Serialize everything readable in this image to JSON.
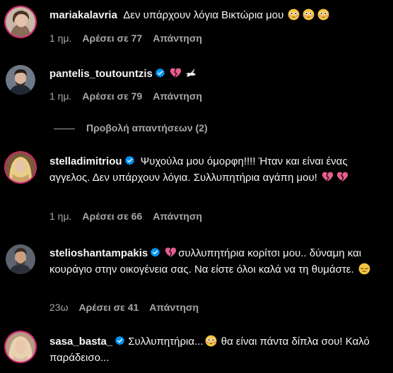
{
  "comments": [
    {
      "username": "mariakalavria",
      "verified": false,
      "text": "Δεν υπάρχουν λόγια Βικτώρια μου",
      "emojis": [
        "flushed-emoji",
        "flushed-emoji",
        "flushed-emoji"
      ],
      "time": "1 ημ.",
      "likes": "Αρέσει σε 77",
      "reply": "Απάντηση"
    },
    {
      "username": "pantelis_toutountzis",
      "verified": true,
      "text": "",
      "emojis": [
        "broken-heart-emoji",
        "dove-emoji"
      ],
      "time": "1 ημ.",
      "likes": "Αρέσει σε 79",
      "reply": "Απάντηση"
    },
    {
      "username": "stelladimitriou",
      "verified": true,
      "text": "Ψυχούλα μου όμορφη!!!! Ήταν και είναι ένας αγγελος. Δεν υπάρχουν λόγια. Συλλυπητήρια αγάπη μου!",
      "emojis": [
        "broken-heart-emoji",
        "broken-heart-emoji"
      ],
      "time": "1 ημ.",
      "likes": "Αρέσει σε 66",
      "reply": "Απάντηση"
    },
    {
      "username": "stelioshantampakis",
      "verified": true,
      "text_pre_emoji": "broken-heart-emoji",
      "text": "συλλυπητήρια κορίτσι μου.. δύναμη και κουράγιο στην οικογένεια σας. Να είστε όλοι καλά να τη θυμάστε.",
      "emojis": [
        "pensive-emoji"
      ],
      "time": "23ω",
      "likes": "Αρέσει σε 41",
      "reply": "Απάντηση"
    },
    {
      "username": "sasa_basta_",
      "verified": true,
      "text": "Συλλυπητήρια...",
      "text_after": "θα είναι πάντα δίπλα σου! Καλό παράδεισο...",
      "emojis": [
        "flushed-emoji"
      ]
    }
  ],
  "view_replies": "Προβολή απαντήσεων (2)",
  "colors": {
    "background": "#000000",
    "text": "#f5f5f5",
    "muted": "#a8a8a8",
    "verified": "#0095f6",
    "story_ring": "#d62976"
  }
}
